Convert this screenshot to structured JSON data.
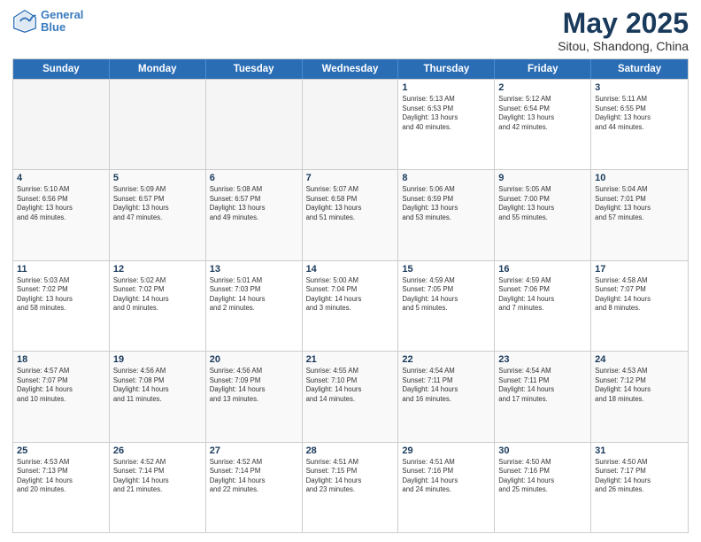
{
  "header": {
    "logo_line1": "General",
    "logo_line2": "Blue",
    "title": "May 2025",
    "subtitle": "Sitou, Shandong, China"
  },
  "days_of_week": [
    "Sunday",
    "Monday",
    "Tuesday",
    "Wednesday",
    "Thursday",
    "Friday",
    "Saturday"
  ],
  "weeks": [
    [
      {
        "day": "",
        "empty": true
      },
      {
        "day": "",
        "empty": true
      },
      {
        "day": "",
        "empty": true
      },
      {
        "day": "",
        "empty": true
      },
      {
        "day": "1",
        "info": "Sunrise: 5:13 AM\nSunset: 6:53 PM\nDaylight: 13 hours\nand 40 minutes."
      },
      {
        "day": "2",
        "info": "Sunrise: 5:12 AM\nSunset: 6:54 PM\nDaylight: 13 hours\nand 42 minutes."
      },
      {
        "day": "3",
        "info": "Sunrise: 5:11 AM\nSunset: 6:55 PM\nDaylight: 13 hours\nand 44 minutes."
      }
    ],
    [
      {
        "day": "4",
        "info": "Sunrise: 5:10 AM\nSunset: 6:56 PM\nDaylight: 13 hours\nand 46 minutes."
      },
      {
        "day": "5",
        "info": "Sunrise: 5:09 AM\nSunset: 6:57 PM\nDaylight: 13 hours\nand 47 minutes."
      },
      {
        "day": "6",
        "info": "Sunrise: 5:08 AM\nSunset: 6:57 PM\nDaylight: 13 hours\nand 49 minutes."
      },
      {
        "day": "7",
        "info": "Sunrise: 5:07 AM\nSunset: 6:58 PM\nDaylight: 13 hours\nand 51 minutes."
      },
      {
        "day": "8",
        "info": "Sunrise: 5:06 AM\nSunset: 6:59 PM\nDaylight: 13 hours\nand 53 minutes."
      },
      {
        "day": "9",
        "info": "Sunrise: 5:05 AM\nSunset: 7:00 PM\nDaylight: 13 hours\nand 55 minutes."
      },
      {
        "day": "10",
        "info": "Sunrise: 5:04 AM\nSunset: 7:01 PM\nDaylight: 13 hours\nand 57 minutes."
      }
    ],
    [
      {
        "day": "11",
        "info": "Sunrise: 5:03 AM\nSunset: 7:02 PM\nDaylight: 13 hours\nand 58 minutes."
      },
      {
        "day": "12",
        "info": "Sunrise: 5:02 AM\nSunset: 7:02 PM\nDaylight: 14 hours\nand 0 minutes."
      },
      {
        "day": "13",
        "info": "Sunrise: 5:01 AM\nSunset: 7:03 PM\nDaylight: 14 hours\nand 2 minutes."
      },
      {
        "day": "14",
        "info": "Sunrise: 5:00 AM\nSunset: 7:04 PM\nDaylight: 14 hours\nand 3 minutes."
      },
      {
        "day": "15",
        "info": "Sunrise: 4:59 AM\nSunset: 7:05 PM\nDaylight: 14 hours\nand 5 minutes."
      },
      {
        "day": "16",
        "info": "Sunrise: 4:59 AM\nSunset: 7:06 PM\nDaylight: 14 hours\nand 7 minutes."
      },
      {
        "day": "17",
        "info": "Sunrise: 4:58 AM\nSunset: 7:07 PM\nDaylight: 14 hours\nand 8 minutes."
      }
    ],
    [
      {
        "day": "18",
        "info": "Sunrise: 4:57 AM\nSunset: 7:07 PM\nDaylight: 14 hours\nand 10 minutes."
      },
      {
        "day": "19",
        "info": "Sunrise: 4:56 AM\nSunset: 7:08 PM\nDaylight: 14 hours\nand 11 minutes."
      },
      {
        "day": "20",
        "info": "Sunrise: 4:56 AM\nSunset: 7:09 PM\nDaylight: 14 hours\nand 13 minutes."
      },
      {
        "day": "21",
        "info": "Sunrise: 4:55 AM\nSunset: 7:10 PM\nDaylight: 14 hours\nand 14 minutes."
      },
      {
        "day": "22",
        "info": "Sunrise: 4:54 AM\nSunset: 7:11 PM\nDaylight: 14 hours\nand 16 minutes."
      },
      {
        "day": "23",
        "info": "Sunrise: 4:54 AM\nSunset: 7:11 PM\nDaylight: 14 hours\nand 17 minutes."
      },
      {
        "day": "24",
        "info": "Sunrise: 4:53 AM\nSunset: 7:12 PM\nDaylight: 14 hours\nand 18 minutes."
      }
    ],
    [
      {
        "day": "25",
        "info": "Sunrise: 4:53 AM\nSunset: 7:13 PM\nDaylight: 14 hours\nand 20 minutes."
      },
      {
        "day": "26",
        "info": "Sunrise: 4:52 AM\nSunset: 7:14 PM\nDaylight: 14 hours\nand 21 minutes."
      },
      {
        "day": "27",
        "info": "Sunrise: 4:52 AM\nSunset: 7:14 PM\nDaylight: 14 hours\nand 22 minutes."
      },
      {
        "day": "28",
        "info": "Sunrise: 4:51 AM\nSunset: 7:15 PM\nDaylight: 14 hours\nand 23 minutes."
      },
      {
        "day": "29",
        "info": "Sunrise: 4:51 AM\nSunset: 7:16 PM\nDaylight: 14 hours\nand 24 minutes."
      },
      {
        "day": "30",
        "info": "Sunrise: 4:50 AM\nSunset: 7:16 PM\nDaylight: 14 hours\nand 25 minutes."
      },
      {
        "day": "31",
        "info": "Sunrise: 4:50 AM\nSunset: 7:17 PM\nDaylight: 14 hours\nand 26 minutes."
      }
    ]
  ]
}
